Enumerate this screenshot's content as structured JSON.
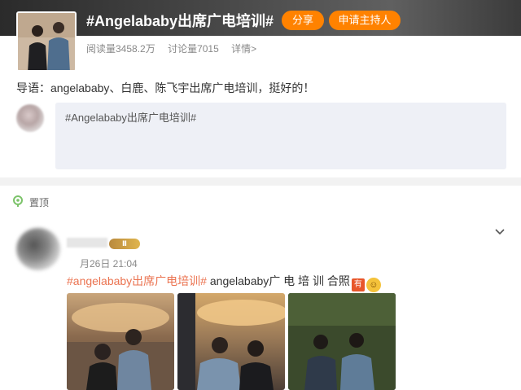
{
  "topic": {
    "title": "#Angelababy出席广电培训#",
    "share_label": "分享",
    "host_label": "申请主持人",
    "read_count": "阅读量3458.2万",
    "discuss_count": "讨论量7015",
    "detail_link": "详情>",
    "intro": "导语：angelababy、白鹿、陈飞宇出席广电培训，挺好的！"
  },
  "composer": {
    "text": "#Angelababy出席广电培训#"
  },
  "feed": {
    "pin_label": "置顶",
    "post": {
      "vip_badge": "Ⅱ",
      "time": "月26日 21:04",
      "hashtag": "#angelababy出席广电培训#",
      "text": " angelababy广 电 培 训 合照",
      "emoji_badge": "有",
      "photos": [
        "group-photo-1",
        "group-photo-2",
        "group-photo-3"
      ]
    }
  },
  "colors": {
    "accent": "#ff8200",
    "tag": "#eb7350"
  },
  "icons": [
    "pin-icon",
    "chevron-down-icon"
  ]
}
